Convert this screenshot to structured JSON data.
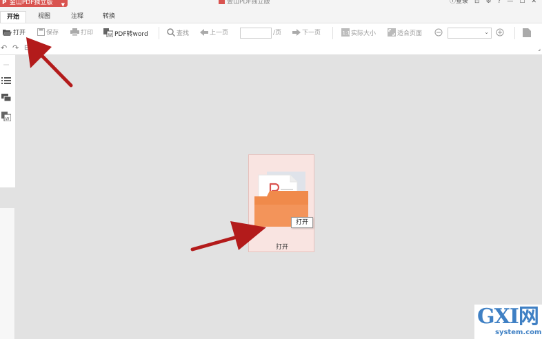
{
  "app": {
    "badge": "金山PDF独立版",
    "document_title": "金山PDF独立版"
  },
  "window": {
    "login_label": "登录"
  },
  "tabs": [
    {
      "label": "开始",
      "active": true
    },
    {
      "label": "视图",
      "active": false
    },
    {
      "label": "注释",
      "active": false
    },
    {
      "label": "转换",
      "active": false
    }
  ],
  "toolbar": {
    "open": "打开",
    "save": "保存",
    "print": "打印",
    "pdf_to_word": "PDF转word",
    "find": "查找",
    "prev_page": "上一页",
    "page_value": "",
    "page_suffix": "/页",
    "next_page": "下一页",
    "actual_size": "实际大小",
    "fit_page": "适合页面",
    "zoom_value": ""
  },
  "open_card": {
    "label": "打开",
    "tooltip": "打开"
  },
  "watermark": {
    "logo_text": "GXI网",
    "url": "system.com"
  },
  "colors": {
    "brand_red": "#d9534f",
    "arrow_red": "#b31b1b",
    "card_bg": "#f9e4e1",
    "folder_orange": "#f08a4b",
    "watermark_blue": "#3f80c4"
  }
}
